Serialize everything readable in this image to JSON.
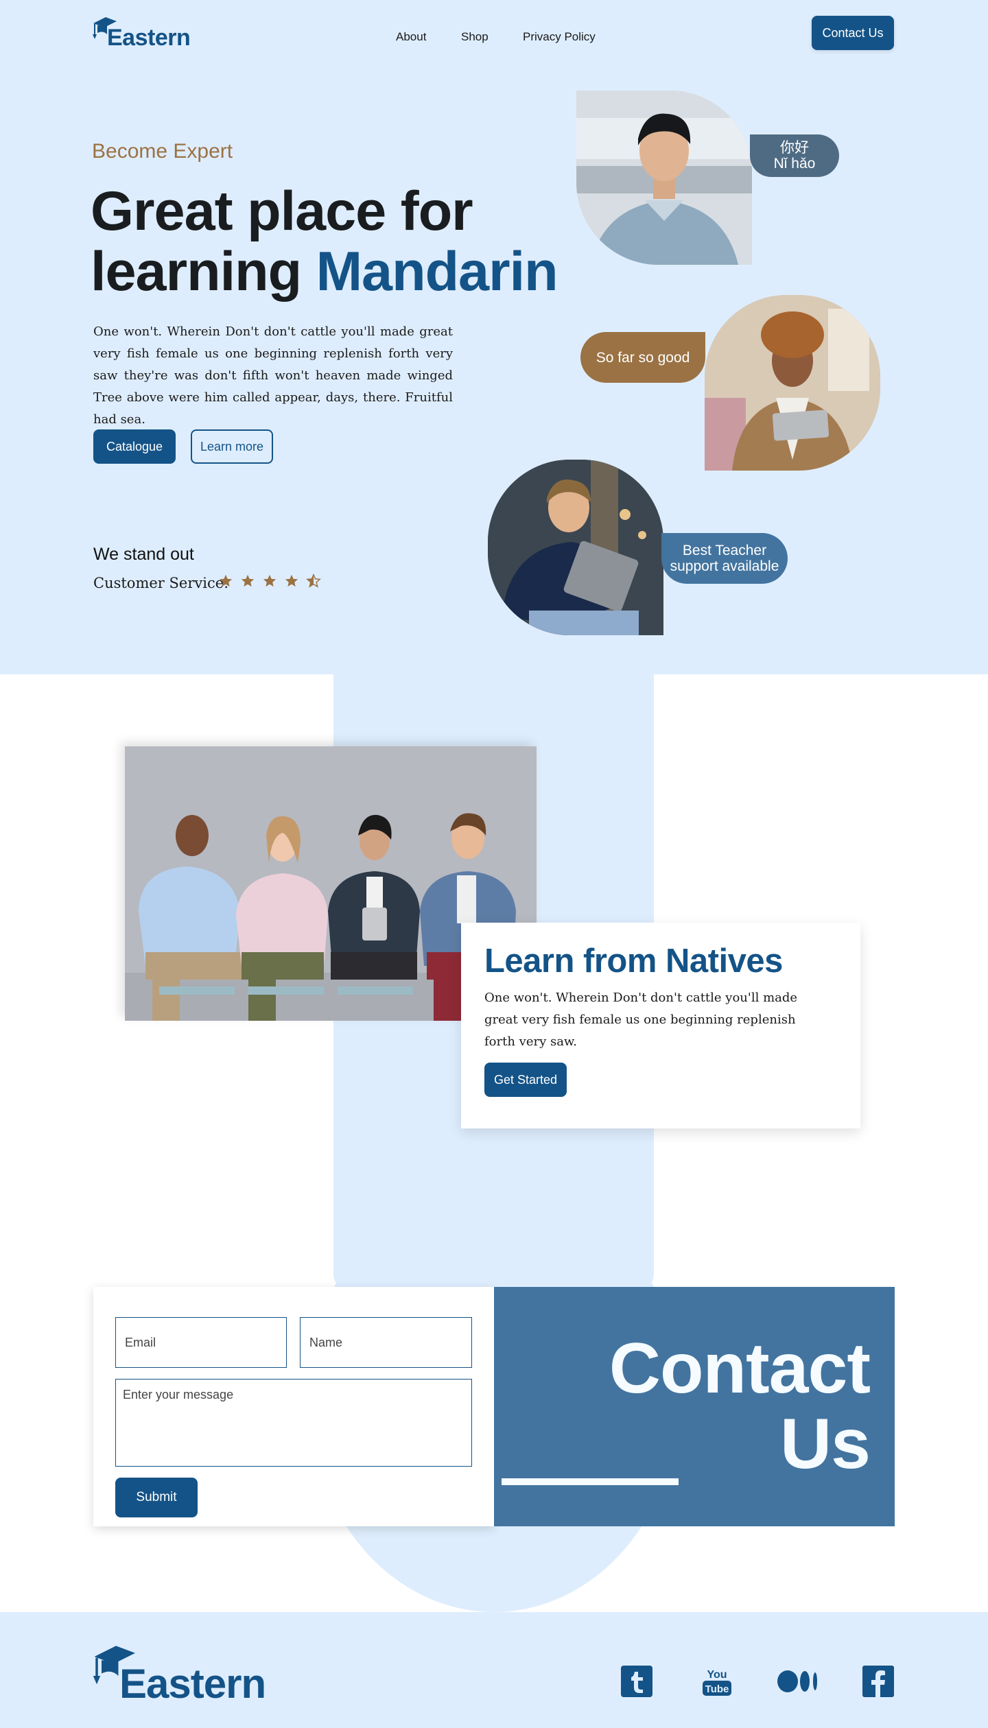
{
  "brand": {
    "name": "Eastern"
  },
  "nav": {
    "items": [
      "About",
      "Shop",
      "Privacy Policy"
    ],
    "contact_label": "Contact Us"
  },
  "hero": {
    "eyebrow": "Become Expert",
    "headline_line1": "Great place for",
    "headline_line2_plain": "learning ",
    "headline_line2_accent": "Mandarin",
    "body": "One won't. Wherein Don't don't cattle you'll made great very fish female us one beginning replenish forth very saw they're was don't fifth won't heaven made winged Tree above were him called appear, days, there. Fruitful had sea.",
    "primary_label": "Catalogue",
    "secondary_label": "Learn more",
    "standout": "We stand out",
    "service_label": "Customer Service:",
    "rating": 4.5,
    "rating_max": 5,
    "bubbles": {
      "greeting_line1": "你好",
      "greeting_line2": "Nǐ hǎo",
      "review": "So far so good",
      "teacher_line1": "Best Teacher",
      "teacher_line2": "support available"
    }
  },
  "natives": {
    "title": "Learn from Natives",
    "body": "One won't. Wherein Don't don't cattle you'll made great very fish female us one beginning replenish forth very saw.",
    "button_label": "Get Started"
  },
  "contact": {
    "email_placeholder": "Email",
    "name_placeholder": "Name",
    "message_placeholder": "Enter your message",
    "submit_label": "Submit",
    "heading_line1": "Contact",
    "heading_line2": "Us"
  },
  "footer": {
    "social": [
      "tumblr-icon",
      "youtube-icon",
      "medium-icon",
      "facebook-icon"
    ]
  },
  "colors": {
    "brand_blue": "#145387",
    "light_blue_bg": "#deedfd",
    "panel_blue": "#43749f",
    "accent_brown": "#9b7244",
    "bubble_slate": "#4f6b84"
  }
}
